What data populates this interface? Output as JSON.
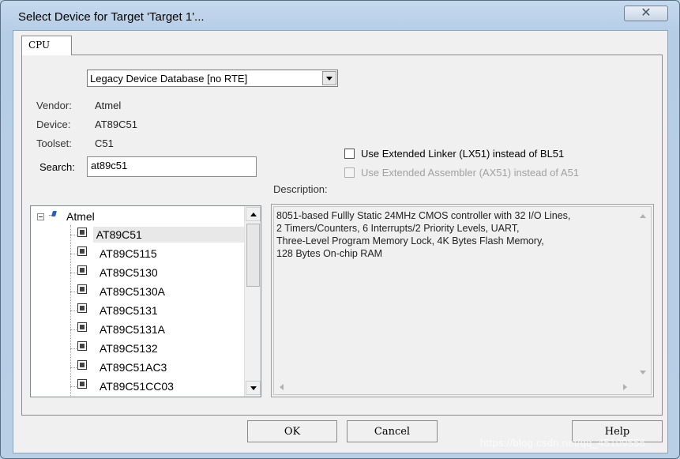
{
  "window": {
    "title": "Select Device for Target 'Target 1'...",
    "close_glyph": "✕"
  },
  "tabs": [
    {
      "label": "CPU",
      "active": true
    }
  ],
  "database_select": {
    "value": "Legacy Device Database [no RTE]"
  },
  "info": {
    "vendor_label": "Vendor:",
    "vendor_value": "Atmel",
    "device_label": "Device:",
    "device_value": "AT89C51",
    "toolset_label": "Toolset:",
    "toolset_value": "C51",
    "search_label": "Search:",
    "search_value": "at89c51"
  },
  "options": {
    "extended_linker": {
      "label": "Use Extended Linker (LX51) instead of BL51",
      "checked": false,
      "enabled": true
    },
    "extended_assembler": {
      "label": "Use Extended Assembler (AX51) instead of A51",
      "checked": false,
      "enabled": false
    }
  },
  "device_tree": {
    "root": "Atmel",
    "root_icon": "vendor-icon",
    "item_icon": "chip-icon",
    "items": [
      {
        "label": "AT89C51",
        "selected": true
      },
      {
        "label": "AT89C5115",
        "selected": false
      },
      {
        "label": "AT89C5130",
        "selected": false
      },
      {
        "label": "AT89C5130A",
        "selected": false
      },
      {
        "label": "AT89C5131",
        "selected": false
      },
      {
        "label": "AT89C5131A",
        "selected": false
      },
      {
        "label": "AT89C5132",
        "selected": false
      },
      {
        "label": "AT89C51AC3",
        "selected": false
      },
      {
        "label": "AT89C51CC03",
        "selected": false
      }
    ]
  },
  "description": {
    "label": "Description:",
    "text": "8051-based Fullly Static 24MHz CMOS controller with 32  I/O Lines,\n2 Timers/Counters, 6 Interrupts/2 Priority Levels, UART,\nThree-Level Program Memory Lock, 4K Bytes Flash Memory,\n128 Bytes On-chip RAM"
  },
  "buttons": {
    "ok": "OK",
    "cancel": "Cancel",
    "help": "Help"
  },
  "watermark": "https://blog.csdn.net/qq_45109556",
  "colors": {
    "window_frame": "#b9cfe6",
    "dialog_bg": "#f0f0f0",
    "selection": "#e8e8e8"
  }
}
